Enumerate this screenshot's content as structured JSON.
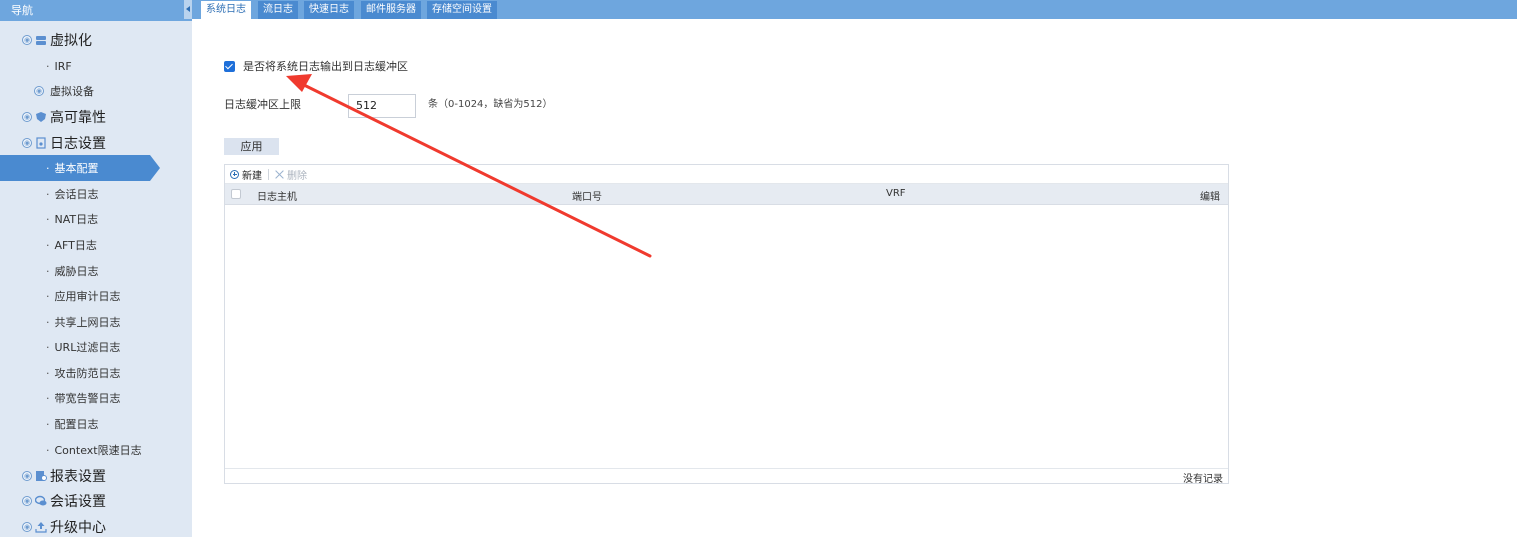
{
  "nav": {
    "header": "导航",
    "items": [
      {
        "label": "虚拟化",
        "level": 1
      },
      {
        "label": "IRF",
        "level": 2
      },
      {
        "label": "虚拟设备",
        "level": 2
      },
      {
        "label": "高可靠性",
        "level": 1
      },
      {
        "label": "日志设置",
        "level": 1
      },
      {
        "label": "基本配置",
        "level": 2,
        "active": true
      },
      {
        "label": "会话日志",
        "level": 2
      },
      {
        "label": "NAT日志",
        "level": 2
      },
      {
        "label": "AFT日志",
        "level": 2
      },
      {
        "label": "威胁日志",
        "level": 2
      },
      {
        "label": "应用审计日志",
        "level": 2
      },
      {
        "label": "共享上网日志",
        "level": 2
      },
      {
        "label": "URL过滤日志",
        "level": 2
      },
      {
        "label": "攻击防范日志",
        "level": 2
      },
      {
        "label": "带宽告警日志",
        "level": 2
      },
      {
        "label": "配置日志",
        "level": 2
      },
      {
        "label": "Context限速日志",
        "level": 2
      },
      {
        "label": "报表设置",
        "level": 1
      },
      {
        "label": "会话设置",
        "level": 1
      },
      {
        "label": "升级中心",
        "level": 1
      }
    ]
  },
  "tabs": [
    {
      "label": "系统日志",
      "active": true
    },
    {
      "label": "流日志"
    },
    {
      "label": "快速日志"
    },
    {
      "label": "邮件服务器"
    },
    {
      "label": "存储空间设置"
    }
  ],
  "form": {
    "output_checkbox_label": "是否将系统日志输出到日志缓冲区",
    "output_checked": true,
    "limit_label": "日志缓冲区上限",
    "limit_value": "512",
    "limit_hint": "条（0-1024，缺省为512）",
    "apply_label": "应用"
  },
  "grid": {
    "toolbar": {
      "add_label": "新建",
      "delete_label": "删除"
    },
    "columns": [
      "日志主机",
      "端口号",
      "VRF",
      "编辑"
    ],
    "rows": [],
    "empty_text": "没有记录"
  },
  "colors": {
    "header_blue": "#6ea6de",
    "sidebar_bg": "#dfe8f3",
    "active_item": "#4a8ad0",
    "annotation_arrow": "#f03a2e"
  },
  "icons": {
    "virtualization": "server-icon",
    "ha": "shield-icon",
    "log": "document-icon",
    "report": "report-icon",
    "session": "chat-icon",
    "upgrade": "upload-icon"
  }
}
